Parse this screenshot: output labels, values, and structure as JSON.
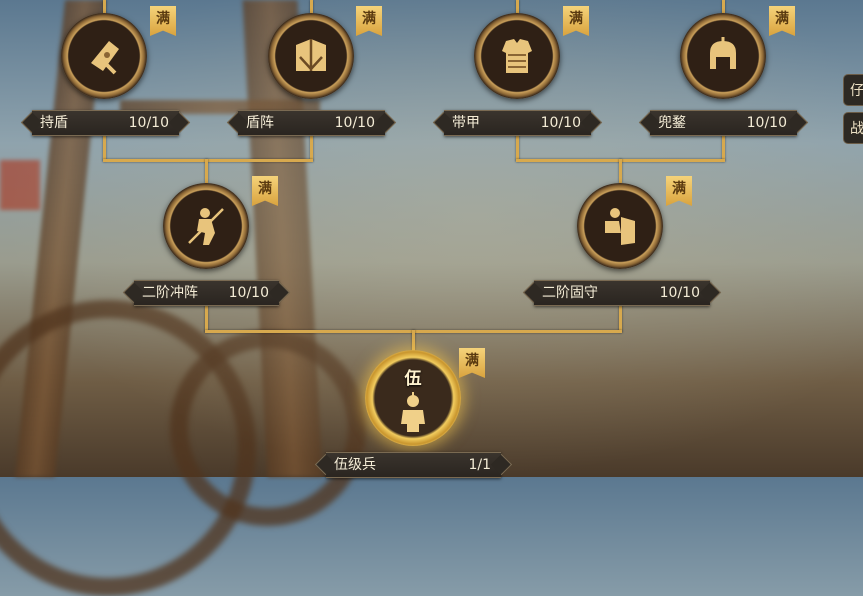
{
  "max_badge": "满",
  "nodes": {
    "chidun": {
      "name": "持盾",
      "count": "10/10",
      "icon": "shield-icon"
    },
    "dunzhen": {
      "name": "盾阵",
      "count": "10/10",
      "icon": "shield-formation-icon"
    },
    "daijia": {
      "name": "带甲",
      "count": "10/10",
      "icon": "armor-icon"
    },
    "doumou": {
      "name": "兜鍪",
      "count": "10/10",
      "icon": "helmet-icon"
    },
    "erjie_chongzhen": {
      "name": "二阶冲阵",
      "count": "10/10",
      "icon": "soldier-charge-icon"
    },
    "erjie_gushou": {
      "name": "二阶固守",
      "count": "10/10",
      "icon": "soldier-defend-icon"
    },
    "wujibing": {
      "name": "伍级兵",
      "count": "1/1",
      "rank": "伍",
      "icon": "soldier-icon"
    }
  },
  "side_tabs": [
    "仔",
    "战"
  ],
  "accent_gold": "#d7a94e"
}
